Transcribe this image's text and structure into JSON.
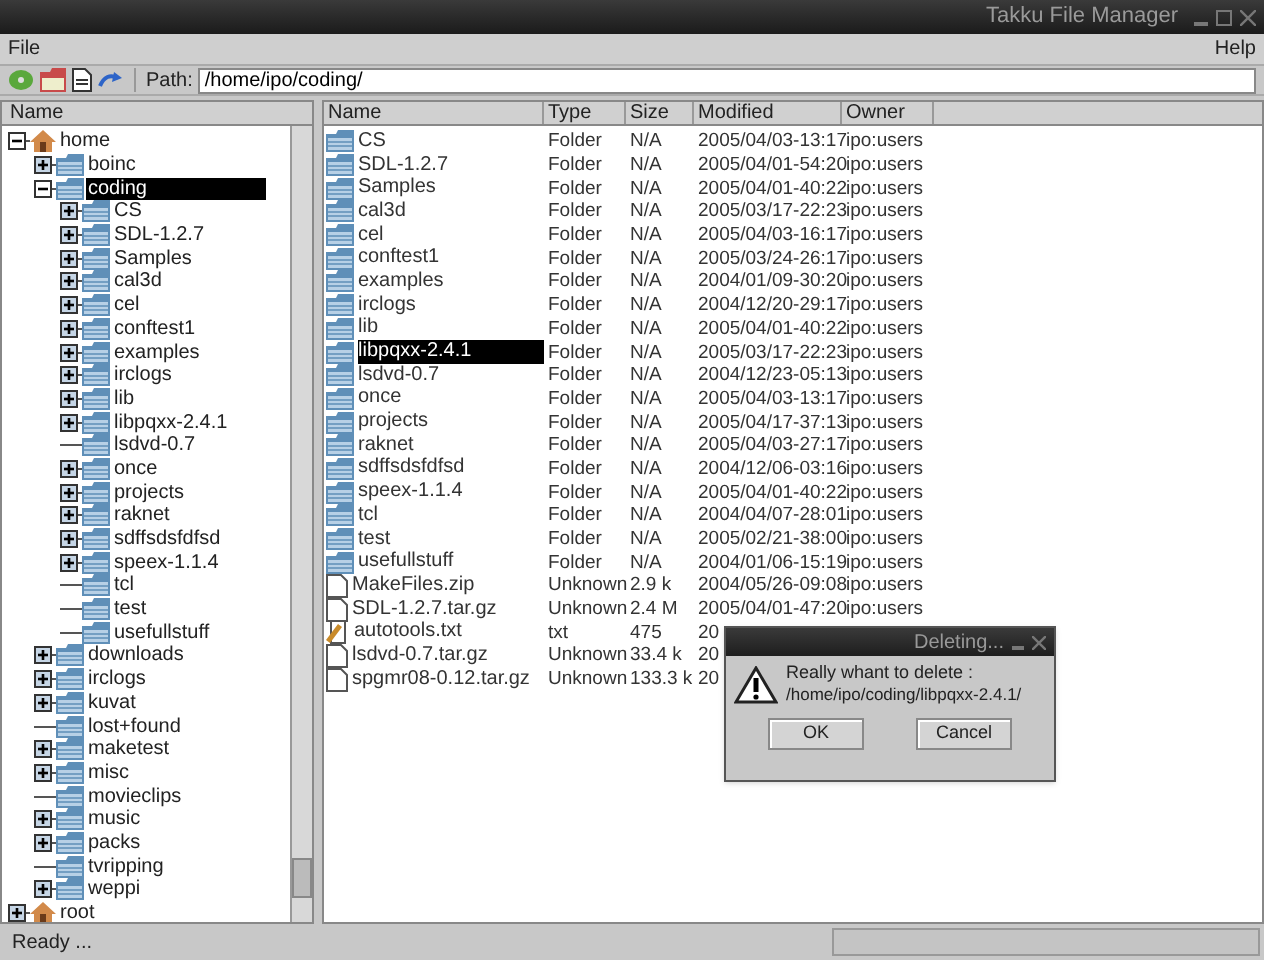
{
  "window": {
    "title": "Takku File Manager"
  },
  "menu": [
    {
      "label": "File"
    },
    {
      "label": "Help"
    }
  ],
  "toolbar": {
    "path_label": "Path:",
    "path": "/home/ipo/coding/"
  },
  "tree": {
    "header": "Name",
    "items": [
      {
        "label": "home",
        "kind": "home",
        "expandable": true,
        "expanded": true,
        "selected": false,
        "children": [
          {
            "label": "boinc",
            "kind": "folder",
            "expandable": true,
            "expanded": false,
            "selected": false
          },
          {
            "label": "coding",
            "kind": "folder",
            "expandable": true,
            "expanded": true,
            "selected": true,
            "children": [
              {
                "label": "CS",
                "kind": "folder",
                "expandable": true,
                "expanded": false,
                "selected": false
              },
              {
                "label": "SDL-1.2.7",
                "kind": "folder",
                "expandable": true,
                "expanded": false,
                "selected": false
              },
              {
                "label": "Samples",
                "kind": "folder",
                "expandable": true,
                "expanded": false,
                "selected": false
              },
              {
                "label": "cal3d",
                "kind": "folder",
                "expandable": true,
                "expanded": false,
                "selected": false
              },
              {
                "label": "cel",
                "kind": "folder",
                "expandable": true,
                "expanded": false,
                "selected": false
              },
              {
                "label": "conftest1",
                "kind": "folder",
                "expandable": true,
                "expanded": false,
                "selected": false
              },
              {
                "label": "examples",
                "kind": "folder",
                "expandable": true,
                "expanded": false,
                "selected": false
              },
              {
                "label": "irclogs",
                "kind": "folder",
                "expandable": true,
                "expanded": false,
                "selected": false
              },
              {
                "label": "lib",
                "kind": "folder",
                "expandable": true,
                "expanded": false,
                "selected": false
              },
              {
                "label": "libpqxx-2.4.1",
                "kind": "folder",
                "expandable": true,
                "expanded": false,
                "selected": false
              },
              {
                "label": "lsdvd-0.7",
                "kind": "folder",
                "expandable": false,
                "selected": false
              },
              {
                "label": "once",
                "kind": "folder",
                "expandable": true,
                "expanded": false,
                "selected": false
              },
              {
                "label": "projects",
                "kind": "folder",
                "expandable": true,
                "expanded": false,
                "selected": false
              },
              {
                "label": "raknet",
                "kind": "folder",
                "expandable": true,
                "expanded": false,
                "selected": false
              },
              {
                "label": "sdffsdsfdfsd",
                "kind": "folder",
                "expandable": true,
                "expanded": false,
                "selected": false
              },
              {
                "label": "speex-1.1.4",
                "kind": "folder",
                "expandable": true,
                "expanded": false,
                "selected": false
              },
              {
                "label": "tcl",
                "kind": "folder",
                "expandable": false,
                "selected": false
              },
              {
                "label": "test",
                "kind": "folder",
                "expandable": false,
                "selected": false
              },
              {
                "label": "usefullstuff",
                "kind": "folder",
                "expandable": false,
                "selected": false
              }
            ]
          },
          {
            "label": "downloads",
            "kind": "folder",
            "expandable": true,
            "expanded": false,
            "selected": false
          },
          {
            "label": "irclogs",
            "kind": "folder",
            "expandable": true,
            "expanded": false,
            "selected": false
          },
          {
            "label": "kuvat",
            "kind": "folder",
            "expandable": true,
            "expanded": false,
            "selected": false
          },
          {
            "label": "lost+found",
            "kind": "folder",
            "expandable": false,
            "selected": false
          },
          {
            "label": "maketest",
            "kind": "folder",
            "expandable": true,
            "expanded": false,
            "selected": false
          },
          {
            "label": "misc",
            "kind": "folder",
            "expandable": true,
            "expanded": false,
            "selected": false
          },
          {
            "label": "movieclips",
            "kind": "folder",
            "expandable": false,
            "selected": false
          },
          {
            "label": "music",
            "kind": "folder",
            "expandable": true,
            "expanded": false,
            "selected": false
          },
          {
            "label": "packs",
            "kind": "folder",
            "expandable": true,
            "expanded": false,
            "selected": false
          },
          {
            "label": "tvripping",
            "kind": "folder",
            "expandable": false,
            "selected": false
          },
          {
            "label": "weppi",
            "kind": "folder",
            "expandable": true,
            "expanded": false,
            "selected": false
          }
        ]
      },
      {
        "label": "root",
        "kind": "home",
        "expandable": true,
        "expanded": false,
        "selected": false
      }
    ]
  },
  "files": {
    "columns": [
      "Name",
      "Type",
      "Size",
      "Modified",
      "Owner"
    ],
    "rows": [
      {
        "name": "CS",
        "type": "Folder",
        "size": "N/A",
        "modified": "2005/04/03-13:17",
        "owner": "ipo:users",
        "kind": "folder",
        "selected": false
      },
      {
        "name": "SDL-1.2.7",
        "type": "Folder",
        "size": "N/A",
        "modified": "2005/04/01-54:20",
        "owner": "ipo:users",
        "kind": "folder",
        "selected": false
      },
      {
        "name": "Samples",
        "type": "Folder",
        "size": "N/A",
        "modified": "2005/04/01-40:22",
        "owner": "ipo:users",
        "kind": "folder",
        "selected": false
      },
      {
        "name": "cal3d",
        "type": "Folder",
        "size": "N/A",
        "modified": "2005/03/17-22:23",
        "owner": "ipo:users",
        "kind": "folder",
        "selected": false
      },
      {
        "name": "cel",
        "type": "Folder",
        "size": "N/A",
        "modified": "2005/04/03-16:17",
        "owner": "ipo:users",
        "kind": "folder",
        "selected": false
      },
      {
        "name": "conftest1",
        "type": "Folder",
        "size": "N/A",
        "modified": "2005/03/24-26:17",
        "owner": "ipo:users",
        "kind": "folder",
        "selected": false
      },
      {
        "name": "examples",
        "type": "Folder",
        "size": "N/A",
        "modified": "2004/01/09-30:20",
        "owner": "ipo:users",
        "kind": "folder",
        "selected": false
      },
      {
        "name": "irclogs",
        "type": "Folder",
        "size": "N/A",
        "modified": "2004/12/20-29:17",
        "owner": "ipo:users",
        "kind": "folder",
        "selected": false
      },
      {
        "name": "lib",
        "type": "Folder",
        "size": "N/A",
        "modified": "2005/04/01-40:22",
        "owner": "ipo:users",
        "kind": "folder",
        "selected": false
      },
      {
        "name": "libpqxx-2.4.1",
        "type": "Folder",
        "size": "N/A",
        "modified": "2005/03/17-22:23",
        "owner": "ipo:users",
        "kind": "folder",
        "selected": true
      },
      {
        "name": "lsdvd-0.7",
        "type": "Folder",
        "size": "N/A",
        "modified": "2004/12/23-05:13",
        "owner": "ipo:users",
        "kind": "folder",
        "selected": false
      },
      {
        "name": "once",
        "type": "Folder",
        "size": "N/A",
        "modified": "2005/04/03-13:17",
        "owner": "ipo:users",
        "kind": "folder",
        "selected": false
      },
      {
        "name": "projects",
        "type": "Folder",
        "size": "N/A",
        "modified": "2005/04/17-37:13",
        "owner": "ipo:users",
        "kind": "folder",
        "selected": false
      },
      {
        "name": "raknet",
        "type": "Folder",
        "size": "N/A",
        "modified": "2005/04/03-27:17",
        "owner": "ipo:users",
        "kind": "folder",
        "selected": false
      },
      {
        "name": "sdffsdsfdfsd",
        "type": "Folder",
        "size": "N/A",
        "modified": "2004/12/06-03:16",
        "owner": "ipo:users",
        "kind": "folder",
        "selected": false
      },
      {
        "name": "speex-1.1.4",
        "type": "Folder",
        "size": "N/A",
        "modified": "2005/04/01-40:22",
        "owner": "ipo:users",
        "kind": "folder",
        "selected": false
      },
      {
        "name": "tcl",
        "type": "Folder",
        "size": "N/A",
        "modified": "2004/04/07-28:01",
        "owner": "ipo:users",
        "kind": "folder",
        "selected": false
      },
      {
        "name": "test",
        "type": "Folder",
        "size": "N/A",
        "modified": "2005/02/21-38:00",
        "owner": "ipo:users",
        "kind": "folder",
        "selected": false
      },
      {
        "name": "usefullstuff",
        "type": "Folder",
        "size": "N/A",
        "modified": "2004/01/06-15:19",
        "owner": "ipo:users",
        "kind": "folder",
        "selected": false
      },
      {
        "name": "MakeFiles.zip",
        "type": "Unknown",
        "size": "2.9 k",
        "modified": "2004/05/26-09:08",
        "owner": "ipo:users",
        "kind": "file",
        "selected": false
      },
      {
        "name": "SDL-1.2.7.tar.gz",
        "type": "Unknown",
        "size": "2.4 M",
        "modified": "2005/04/01-47:20",
        "owner": "ipo:users",
        "kind": "file",
        "selected": false
      },
      {
        "name": "autotools.txt",
        "type": "txt",
        "size": "475",
        "modified": "20",
        "kind": "text",
        "selected": false
      },
      {
        "name": "lsdvd-0.7.tar.gz",
        "type": "Unknown",
        "size": "33.4 k",
        "modified": "20",
        "kind": "file",
        "selected": false
      },
      {
        "name": "spgmr08-0.12.tar.gz",
        "type": "Unknown",
        "size": "133.3 k",
        "modified": "20",
        "kind": "file",
        "selected": false
      }
    ]
  },
  "status_bar": {
    "text": "Ready ..."
  },
  "dialog": {
    "title": "Deleting...",
    "message": "Really whant to delete :",
    "path": "/home/ipo/coding/libpqxx-2.4.1/",
    "buttons": [
      "OK",
      "Cancel"
    ]
  }
}
